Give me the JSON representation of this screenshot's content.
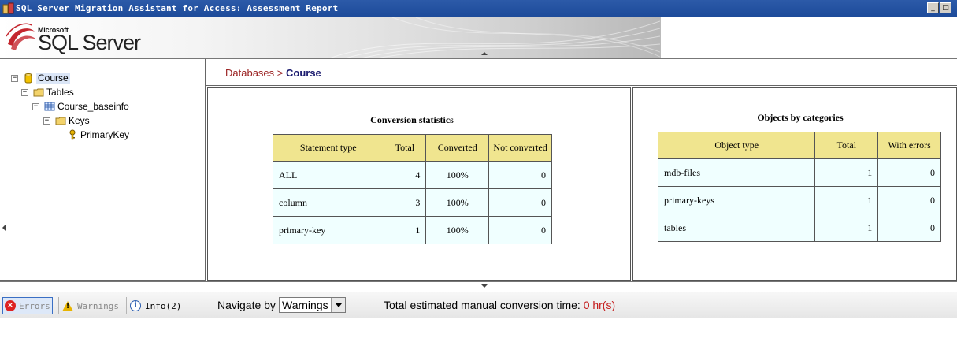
{
  "window": {
    "title": "SQL Server Migration Assistant for Access: Assessment Report",
    "buttons": {
      "minimize": "_",
      "maximize": "□"
    }
  },
  "banner": {
    "brand_small": "Microsoft",
    "brand_large": "SQL Server"
  },
  "tree": {
    "nodes": [
      {
        "label": "Course",
        "icon": "database-icon",
        "expander": "−",
        "selected": true
      },
      {
        "label": "Tables",
        "icon": "folder-icon",
        "expander": "−"
      },
      {
        "label": "Course_baseinfo",
        "icon": "table-icon",
        "expander": "−"
      },
      {
        "label": "Keys",
        "icon": "folder-icon",
        "expander": "−"
      },
      {
        "label": "PrimaryKey",
        "icon": "key-icon"
      }
    ]
  },
  "breadcrumb": {
    "parent": "Databases",
    "separator": " > ",
    "current": "Course"
  },
  "conversion": {
    "title": "Conversion statistics",
    "columns": [
      "Statement type",
      "Total",
      "Converted",
      "Not converted"
    ],
    "rows": [
      {
        "type": "ALL",
        "total": "4",
        "converted": "100%",
        "not_converted": "0"
      },
      {
        "type": "column",
        "total": "3",
        "converted": "100%",
        "not_converted": "0"
      },
      {
        "type": "primary-key",
        "total": "1",
        "converted": "100%",
        "not_converted": "0"
      }
    ]
  },
  "objects": {
    "title": "Objects by categories",
    "columns": [
      "Object type",
      "Total",
      "With errors"
    ],
    "rows": [
      {
        "type": "mdb-files",
        "total": "1",
        "errors": "0"
      },
      {
        "type": "primary-keys",
        "total": "1",
        "errors": "0"
      },
      {
        "type": "tables",
        "total": "1",
        "errors": "0"
      }
    ]
  },
  "messages": {
    "errors_label": "Errors",
    "warnings_label": "Warnings",
    "info_label": "Info(2)",
    "navigate_label": "Navigate by",
    "navigate_value": "Warnings",
    "estimate_label": "Total estimated manual conversion time: ",
    "estimate_value": "0 hr(s)"
  },
  "colors": {
    "header_fill": "#f0e58f",
    "cell_fill": "#f0ffff",
    "breadcrumb_parent": "#9b2323",
    "estimate_value": "#c41a1a",
    "titlebar": "#2c5aa8"
  }
}
